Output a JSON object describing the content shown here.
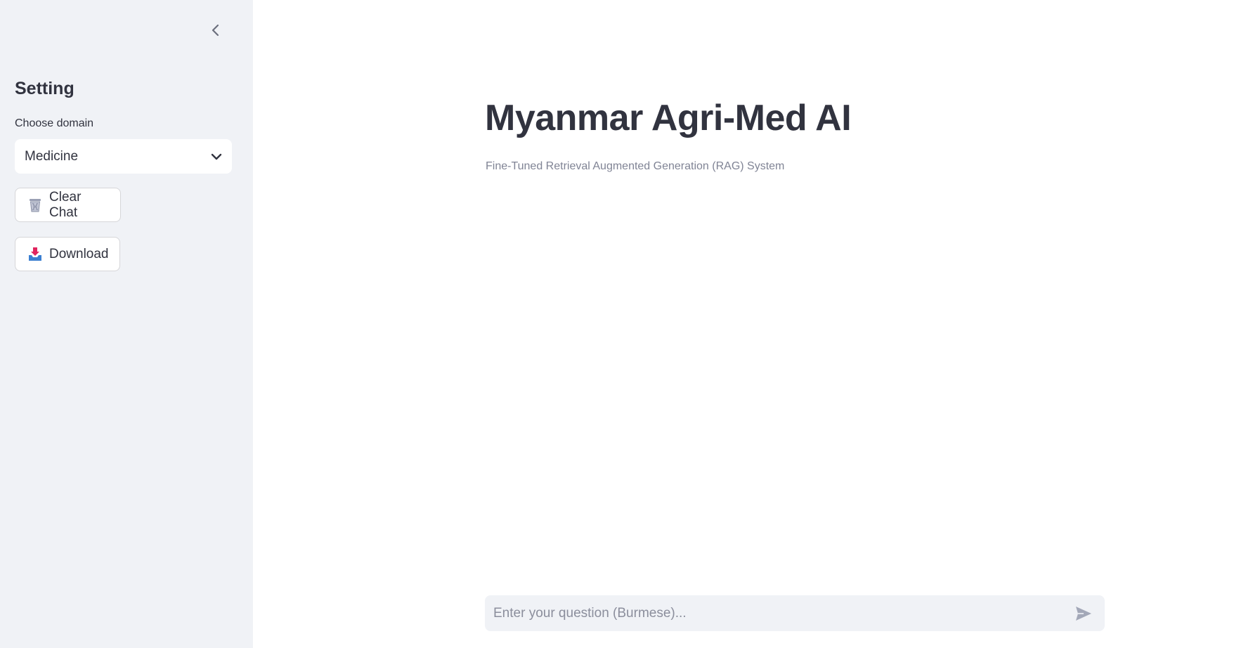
{
  "sidebar": {
    "collapse_icon": "chevron-left-icon",
    "title": "Setting",
    "domain_label": "Choose domain",
    "domain_selected": "Medicine",
    "dropdown_icon": "chevron-down-icon",
    "clear_button": {
      "icon": "wastebasket-icon",
      "label": "Clear Chat"
    },
    "download_button": {
      "icon": "inbox-tray-icon",
      "label": "Download"
    }
  },
  "main": {
    "title": "Myanmar Agri-Med AI",
    "subtitle": "Fine-Tuned Retrieval Augmented Generation (RAG) System"
  },
  "chat": {
    "placeholder": "Enter your question (Burmese)...",
    "send_icon": "send-icon"
  },
  "colors": {
    "sidebar_bg": "#f0f2f6",
    "text": "#31333f",
    "muted_text": "#808495",
    "input_bg": "#f0f2f6"
  }
}
